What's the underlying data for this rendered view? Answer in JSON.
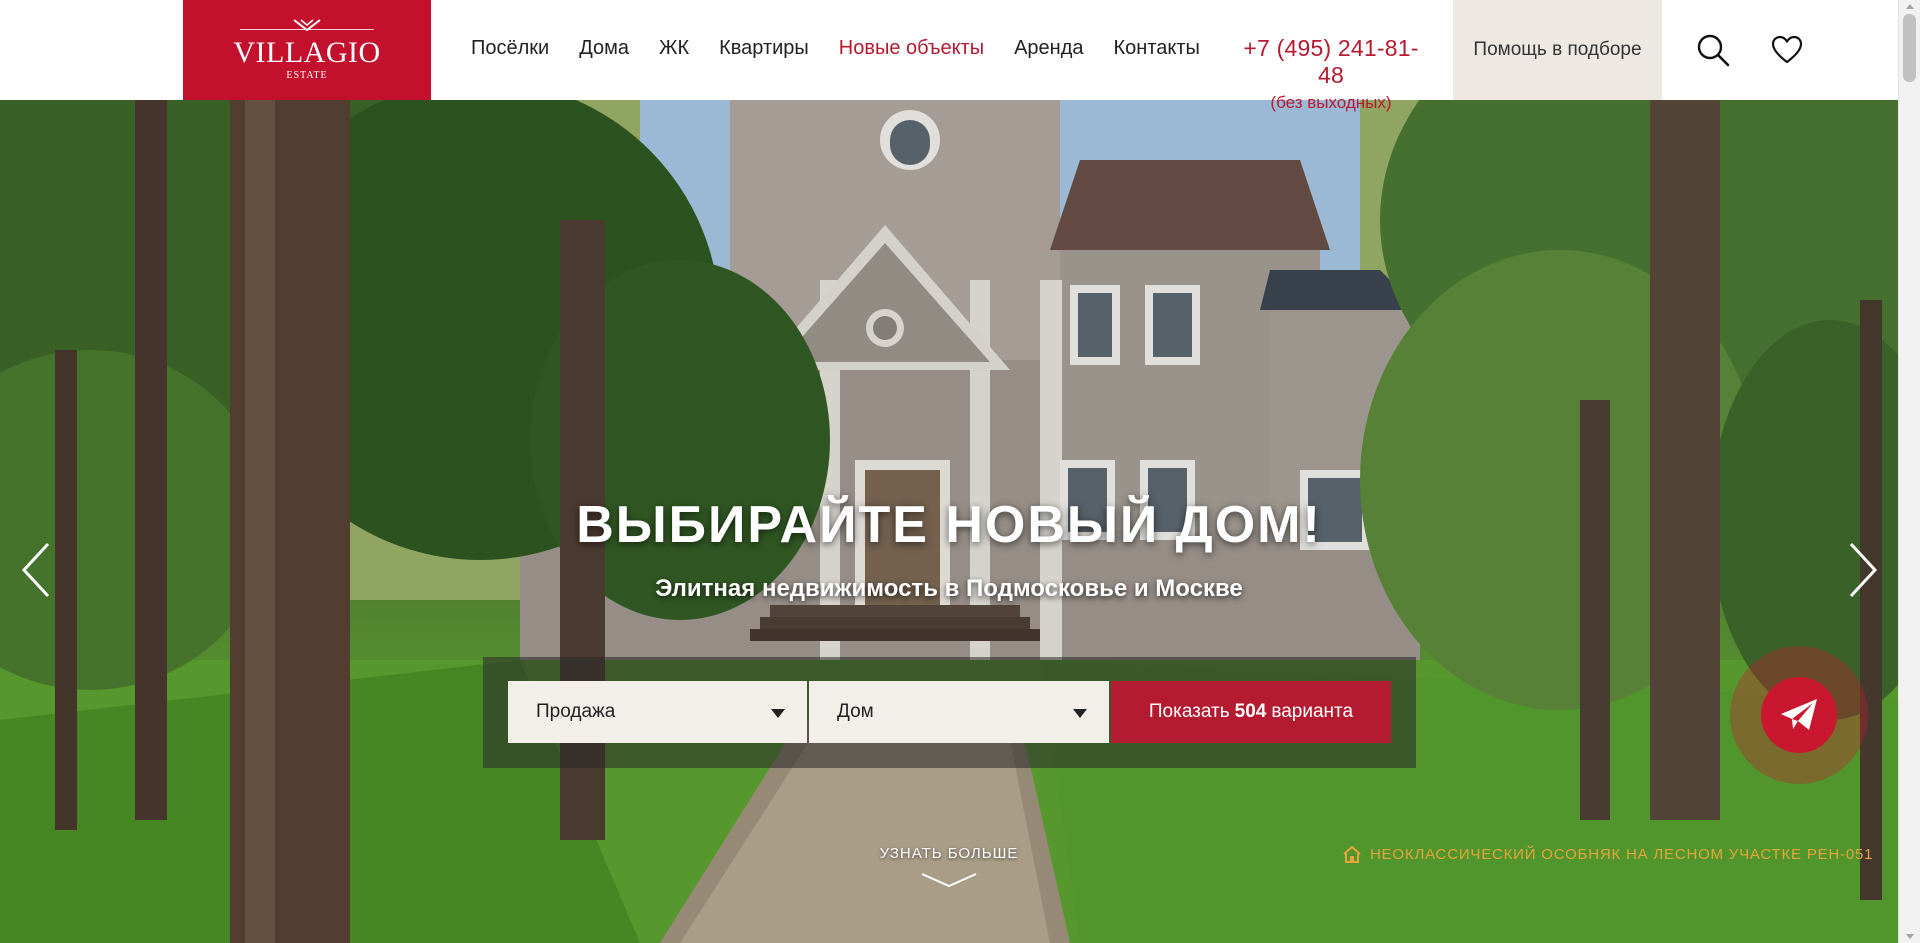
{
  "header": {
    "logo": {
      "title": "VILLAGIO",
      "subtitle": "ESTATE"
    },
    "nav": [
      {
        "label": "Посёлки",
        "active": false
      },
      {
        "label": "Дома",
        "active": false
      },
      {
        "label": "ЖК",
        "active": false
      },
      {
        "label": "Квартиры",
        "active": false
      },
      {
        "label": "Новые объекты",
        "active": true
      },
      {
        "label": "Аренда",
        "active": false
      },
      {
        "label": "Контакты",
        "active": false
      }
    ],
    "phone": "+7 (495) 241-81-48",
    "phone_note": "(без выходных)",
    "help_label": "Помощь в подборе",
    "search_icon": "search-icon",
    "favorites_icon": "heart-icon"
  },
  "hero": {
    "title": "ВЫБИРАЙТЕ НОВЫЙ ДОМ!",
    "subtitle": "Элитная недвижимость в Подмосковье и Москве",
    "prev_icon": "chevron-left-icon",
    "next_icon": "chevron-right-icon",
    "search": {
      "deal_type": "Продажа",
      "object_type": "Дом",
      "submit_prefix": "Показать",
      "submit_count": "504",
      "submit_suffix": "варианта"
    },
    "more_label": "УЗНАТЬ БОЛЬШЕ",
    "caption": "НЕОКЛАССИЧЕСКИЙ ОСОБНЯК НА ЛЕСНОМ УЧАСТКЕ РЕН-051"
  },
  "colors": {
    "brand": "#c2102d",
    "accent_text": "#b51b30",
    "help_bg": "#ede9e2",
    "select_bg": "#f2efe9",
    "caption": "#e3a63a"
  },
  "telegram_icon": "paper-plane-icon"
}
